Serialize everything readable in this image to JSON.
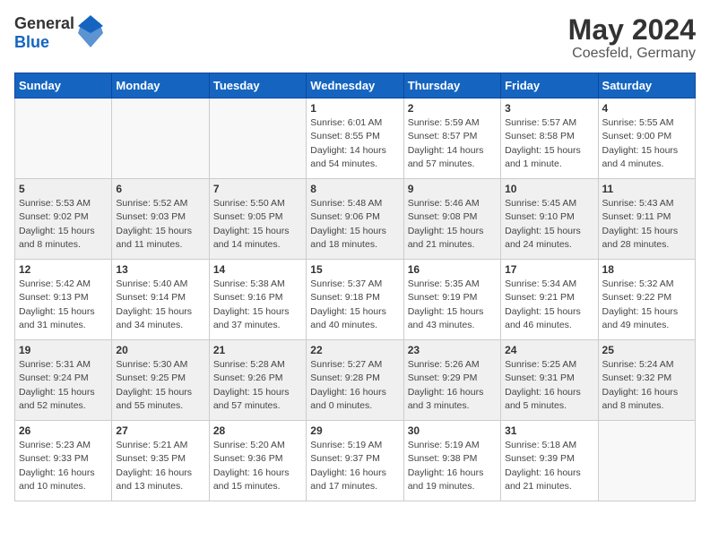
{
  "header": {
    "logo_general": "General",
    "logo_blue": "Blue",
    "title": "May 2024",
    "subtitle": "Coesfeld, Germany"
  },
  "days_of_week": [
    "Sunday",
    "Monday",
    "Tuesday",
    "Wednesday",
    "Thursday",
    "Friday",
    "Saturday"
  ],
  "weeks": [
    [
      {
        "day": "",
        "info": ""
      },
      {
        "day": "",
        "info": ""
      },
      {
        "day": "",
        "info": ""
      },
      {
        "day": "1",
        "info": "Sunrise: 6:01 AM\nSunset: 8:55 PM\nDaylight: 14 hours\nand 54 minutes."
      },
      {
        "day": "2",
        "info": "Sunrise: 5:59 AM\nSunset: 8:57 PM\nDaylight: 14 hours\nand 57 minutes."
      },
      {
        "day": "3",
        "info": "Sunrise: 5:57 AM\nSunset: 8:58 PM\nDaylight: 15 hours\nand 1 minute."
      },
      {
        "day": "4",
        "info": "Sunrise: 5:55 AM\nSunset: 9:00 PM\nDaylight: 15 hours\nand 4 minutes."
      }
    ],
    [
      {
        "day": "5",
        "info": "Sunrise: 5:53 AM\nSunset: 9:02 PM\nDaylight: 15 hours\nand 8 minutes."
      },
      {
        "day": "6",
        "info": "Sunrise: 5:52 AM\nSunset: 9:03 PM\nDaylight: 15 hours\nand 11 minutes."
      },
      {
        "day": "7",
        "info": "Sunrise: 5:50 AM\nSunset: 9:05 PM\nDaylight: 15 hours\nand 14 minutes."
      },
      {
        "day": "8",
        "info": "Sunrise: 5:48 AM\nSunset: 9:06 PM\nDaylight: 15 hours\nand 18 minutes."
      },
      {
        "day": "9",
        "info": "Sunrise: 5:46 AM\nSunset: 9:08 PM\nDaylight: 15 hours\nand 21 minutes."
      },
      {
        "day": "10",
        "info": "Sunrise: 5:45 AM\nSunset: 9:10 PM\nDaylight: 15 hours\nand 24 minutes."
      },
      {
        "day": "11",
        "info": "Sunrise: 5:43 AM\nSunset: 9:11 PM\nDaylight: 15 hours\nand 28 minutes."
      }
    ],
    [
      {
        "day": "12",
        "info": "Sunrise: 5:42 AM\nSunset: 9:13 PM\nDaylight: 15 hours\nand 31 minutes."
      },
      {
        "day": "13",
        "info": "Sunrise: 5:40 AM\nSunset: 9:14 PM\nDaylight: 15 hours\nand 34 minutes."
      },
      {
        "day": "14",
        "info": "Sunrise: 5:38 AM\nSunset: 9:16 PM\nDaylight: 15 hours\nand 37 minutes."
      },
      {
        "day": "15",
        "info": "Sunrise: 5:37 AM\nSunset: 9:18 PM\nDaylight: 15 hours\nand 40 minutes."
      },
      {
        "day": "16",
        "info": "Sunrise: 5:35 AM\nSunset: 9:19 PM\nDaylight: 15 hours\nand 43 minutes."
      },
      {
        "day": "17",
        "info": "Sunrise: 5:34 AM\nSunset: 9:21 PM\nDaylight: 15 hours\nand 46 minutes."
      },
      {
        "day": "18",
        "info": "Sunrise: 5:32 AM\nSunset: 9:22 PM\nDaylight: 15 hours\nand 49 minutes."
      }
    ],
    [
      {
        "day": "19",
        "info": "Sunrise: 5:31 AM\nSunset: 9:24 PM\nDaylight: 15 hours\nand 52 minutes."
      },
      {
        "day": "20",
        "info": "Sunrise: 5:30 AM\nSunset: 9:25 PM\nDaylight: 15 hours\nand 55 minutes."
      },
      {
        "day": "21",
        "info": "Sunrise: 5:28 AM\nSunset: 9:26 PM\nDaylight: 15 hours\nand 57 minutes."
      },
      {
        "day": "22",
        "info": "Sunrise: 5:27 AM\nSunset: 9:28 PM\nDaylight: 16 hours\nand 0 minutes."
      },
      {
        "day": "23",
        "info": "Sunrise: 5:26 AM\nSunset: 9:29 PM\nDaylight: 16 hours\nand 3 minutes."
      },
      {
        "day": "24",
        "info": "Sunrise: 5:25 AM\nSunset: 9:31 PM\nDaylight: 16 hours\nand 5 minutes."
      },
      {
        "day": "25",
        "info": "Sunrise: 5:24 AM\nSunset: 9:32 PM\nDaylight: 16 hours\nand 8 minutes."
      }
    ],
    [
      {
        "day": "26",
        "info": "Sunrise: 5:23 AM\nSunset: 9:33 PM\nDaylight: 16 hours\nand 10 minutes."
      },
      {
        "day": "27",
        "info": "Sunrise: 5:21 AM\nSunset: 9:35 PM\nDaylight: 16 hours\nand 13 minutes."
      },
      {
        "day": "28",
        "info": "Sunrise: 5:20 AM\nSunset: 9:36 PM\nDaylight: 16 hours\nand 15 minutes."
      },
      {
        "day": "29",
        "info": "Sunrise: 5:19 AM\nSunset: 9:37 PM\nDaylight: 16 hours\nand 17 minutes."
      },
      {
        "day": "30",
        "info": "Sunrise: 5:19 AM\nSunset: 9:38 PM\nDaylight: 16 hours\nand 19 minutes."
      },
      {
        "day": "31",
        "info": "Sunrise: 5:18 AM\nSunset: 9:39 PM\nDaylight: 16 hours\nand 21 minutes."
      },
      {
        "day": "",
        "info": ""
      }
    ]
  ]
}
